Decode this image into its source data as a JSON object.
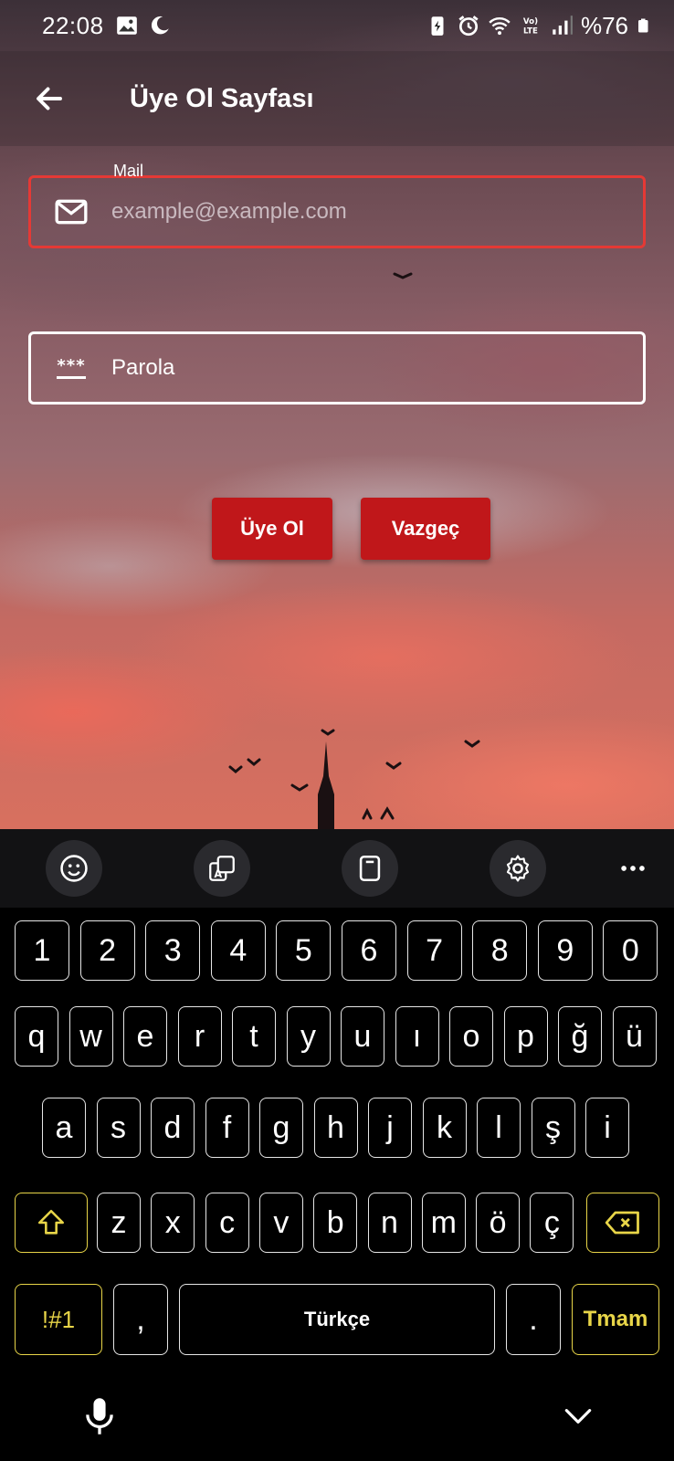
{
  "status_bar": {
    "time": "22:08",
    "battery_text": "%76",
    "icons": [
      "gallery-icon",
      "moon-icon",
      "battery-saver-icon",
      "alarm-icon",
      "wifi-icon",
      "volte-icon",
      "signal-icon",
      "battery-icon"
    ]
  },
  "app_bar": {
    "title": "Üye Ol Sayfası",
    "back_icon": "arrow-left-icon"
  },
  "form": {
    "mail": {
      "label": "Mail",
      "placeholder": "example@example.com",
      "icon": "mail-icon",
      "border_color": "#e53935"
    },
    "password": {
      "placeholder": "Parola",
      "icon": "password-icon",
      "icon_glyph": "***",
      "border_color": "#ffffff"
    }
  },
  "buttons": {
    "signup": "Üye Ol",
    "cancel": "Vazgeç",
    "color": "#c0171a"
  },
  "keyboard": {
    "toolbar": [
      "emoji-icon",
      "translate-icon",
      "clipboard-icon",
      "settings-icon",
      "more-icon"
    ],
    "number_row": [
      "1",
      "2",
      "3",
      "4",
      "5",
      "6",
      "7",
      "8",
      "9",
      "0"
    ],
    "row1": [
      "q",
      "w",
      "e",
      "r",
      "t",
      "y",
      "u",
      "ı",
      "o",
      "p",
      "ğ",
      "ü"
    ],
    "row2": [
      "a",
      "s",
      "d",
      "f",
      "g",
      "h",
      "j",
      "k",
      "l",
      "ş",
      "i"
    ],
    "row3": [
      "z",
      "x",
      "c",
      "v",
      "b",
      "n",
      "m",
      "ö",
      "ç"
    ],
    "symbols_key": "!#1",
    "comma_key": ",",
    "space_label": "Türkçe",
    "period_key": ".",
    "done_key": "Tmam",
    "shift_icon": "shift-icon",
    "backspace_icon": "backspace-icon",
    "accent_color": "#e8d548"
  },
  "nav_bar": {
    "left_icon": "microphone-icon",
    "right_icon": "chevron-down-icon"
  }
}
